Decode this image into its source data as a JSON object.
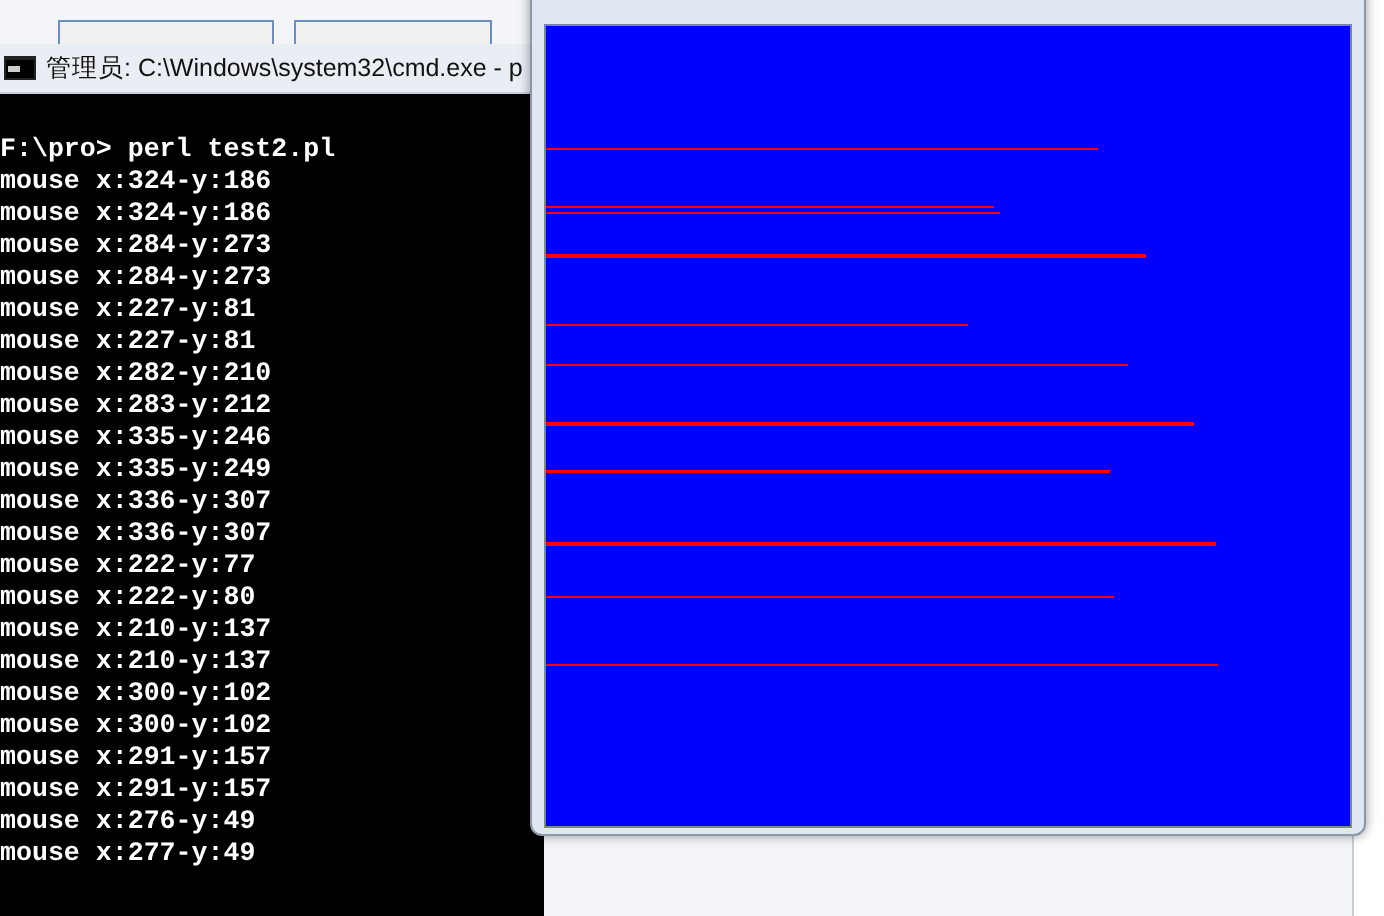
{
  "console_window": {
    "title": "管理员: C:\\Windows\\system32\\cmd.exe - p",
    "lines": [
      "F:\\pro> perl test2.pl",
      "mouse x:324-y:186",
      "mouse x:324-y:186",
      "mouse x:284-y:273",
      "mouse x:284-y:273",
      "mouse x:227-y:81",
      "mouse x:227-y:81",
      "mouse x:282-y:210",
      "mouse x:283-y:212",
      "mouse x:335-y:246",
      "mouse x:335-y:249",
      "mouse x:336-y:307",
      "mouse x:336-y:307",
      "mouse x:222-y:77",
      "mouse x:222-y:80",
      "mouse x:210-y:137",
      "mouse x:210-y:137",
      "mouse x:300-y:102",
      "mouse x:300-y:102",
      "mouse x:291-y:157",
      "mouse x:291-y:157",
      "mouse x:276-y:49",
      "mouse x:277-y:49"
    ]
  }
}
